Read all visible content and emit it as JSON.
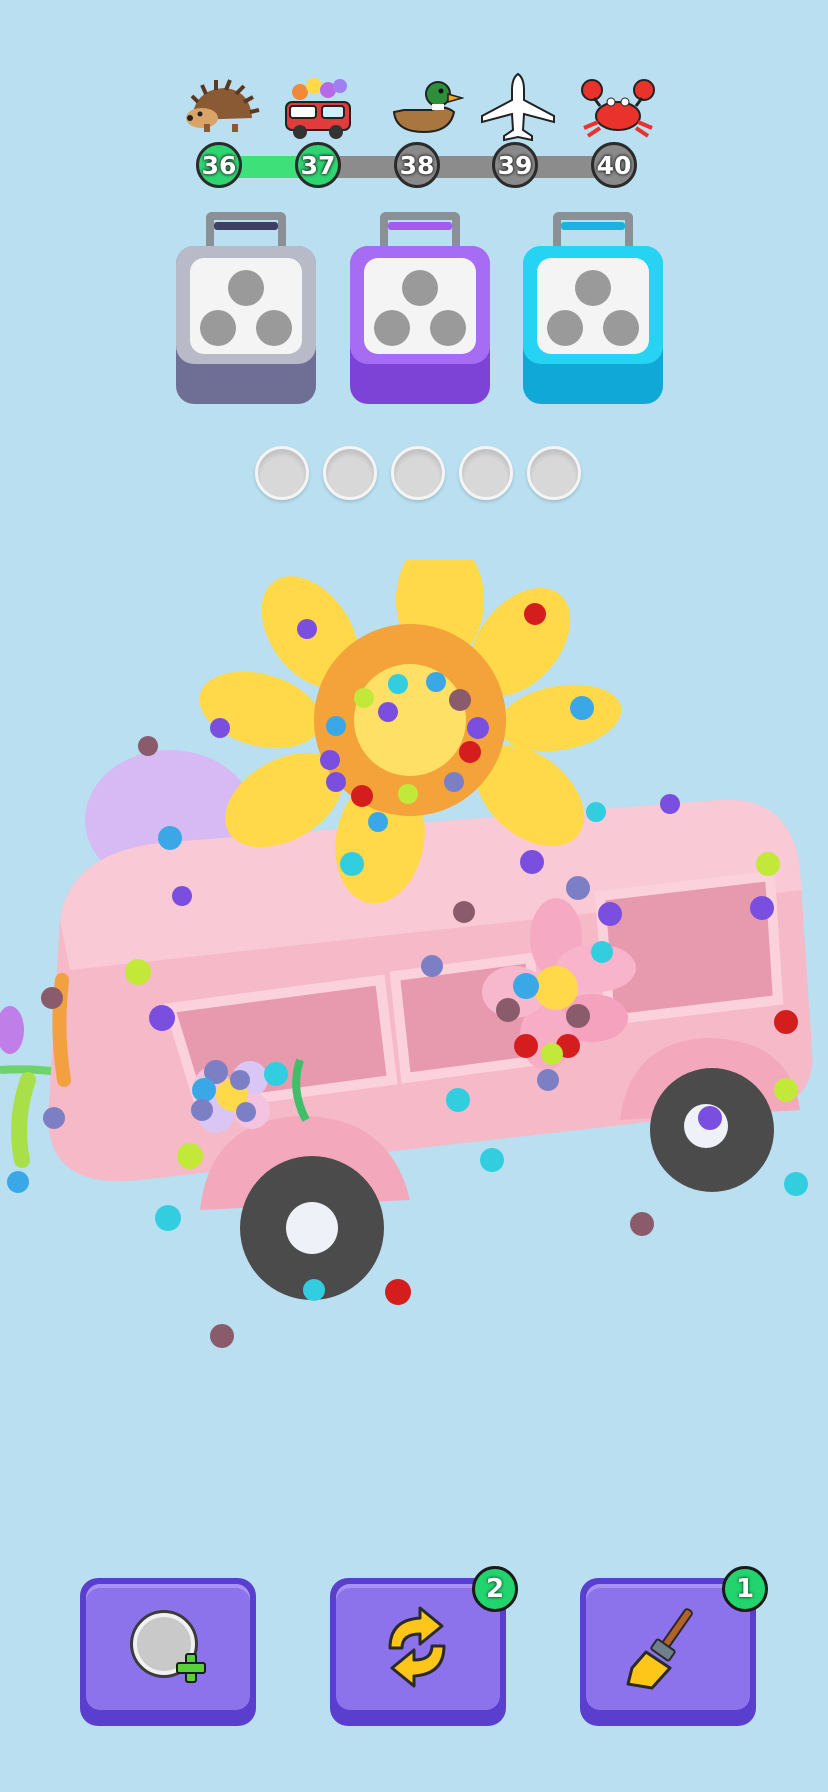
{
  "progress": {
    "levels": [
      {
        "number": "36",
        "icon": "hedgehog-icon",
        "state": "done"
      },
      {
        "number": "37",
        "icon": "flower-van-icon",
        "state": "done"
      },
      {
        "number": "38",
        "icon": "duck-icon",
        "state": "locked"
      },
      {
        "number": "39",
        "icon": "airplane-icon",
        "state": "locked"
      },
      {
        "number": "40",
        "icon": "crab-icon",
        "state": "locked"
      }
    ],
    "fill_color": "#3ee07a",
    "locked_color": "#8a8a8a"
  },
  "boxes": [
    {
      "name": "box-gray",
      "color": "#8a8aa8",
      "dark": "#6f6e94",
      "accent": "#3d3f63",
      "holes": 3
    },
    {
      "name": "box-purple",
      "color": "#9b5ff0",
      "dark": "#7d43d6",
      "accent": "#a35cf2",
      "holes": 3
    },
    {
      "name": "box-cyan",
      "color": "#19c9ec",
      "dark": "#10a8d6",
      "accent": "#1ab3dc",
      "holes": 3
    }
  ],
  "slots": {
    "count": 5,
    "filled": 0
  },
  "scene": {
    "object": "pink flower van",
    "van_color": "#f6b9c8",
    "flower_color": "#ffd94a",
    "screw_colors": [
      "#7a4fe0",
      "#3aa8e6",
      "#d41e1e",
      "#c2e83a",
      "#7d7fc4",
      "#8a5b6b",
      "#33cde0"
    ]
  },
  "boosters": [
    {
      "name": "add-slot",
      "icon": "add-slot-icon",
      "badge": ""
    },
    {
      "name": "shuffle",
      "icon": "shuffle-icon",
      "badge": "2"
    },
    {
      "name": "broom",
      "icon": "broom-icon",
      "badge": "1"
    }
  ]
}
